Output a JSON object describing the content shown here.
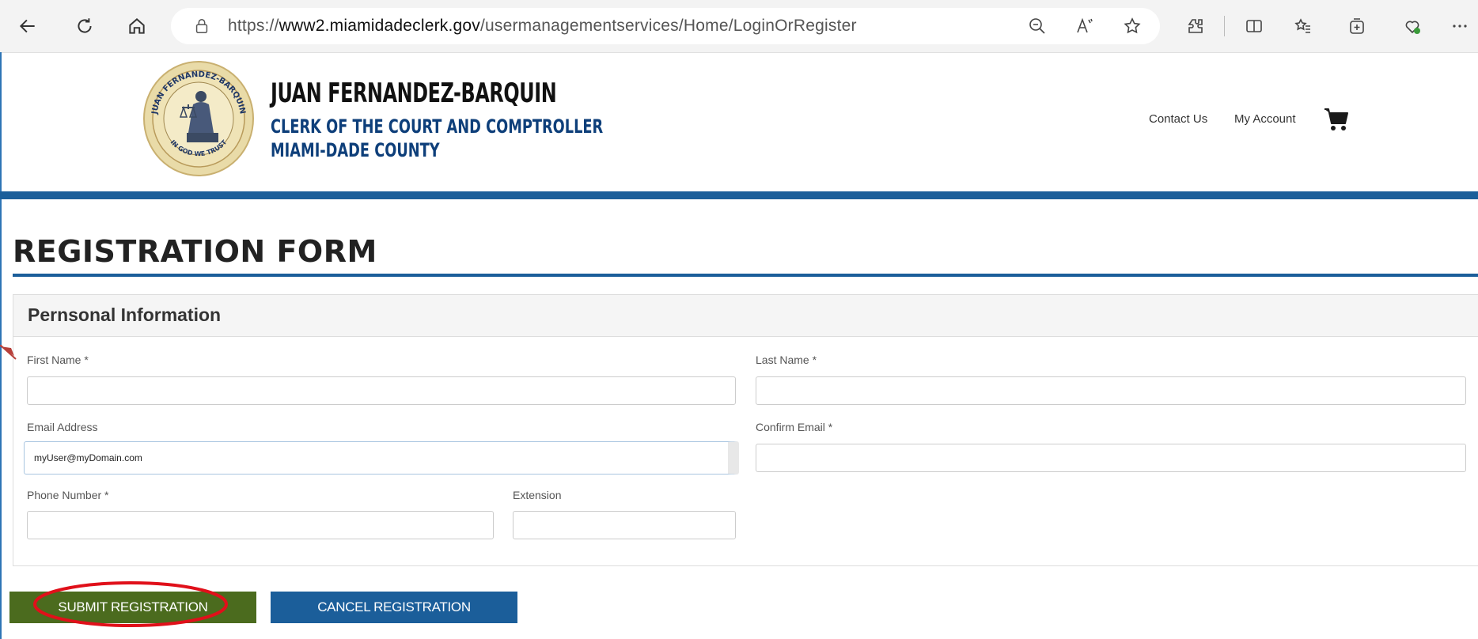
{
  "browser": {
    "url_prefix": "https://",
    "url_domain": "www2.miamidadeclerk.gov",
    "url_path": "/usermanagementservices/Home/LoginOrRegister",
    "icons": [
      "back-icon",
      "refresh-icon",
      "home-icon",
      "lock-icon",
      "zoom-out-icon",
      "read-aloud-icon",
      "favorite-star-icon",
      "extensions-icon",
      "split-screen-icon",
      "favorites-list-icon",
      "collections-icon",
      "browser-essentials-icon",
      "more-icon"
    ]
  },
  "header": {
    "org_name": "JUAN FERNANDEZ-BARQUIN",
    "org_line2": "CLERK OF THE COURT AND COMPTROLLER",
    "org_line3": "MIAMI-DADE COUNTY",
    "seal_top_text": "JUAN FERNANDEZ-BARQUIN",
    "seal_bottom_text": "IN GOD WE TRUST",
    "contact_label": "Contact Us",
    "account_label": "My Account",
    "cart_icon": "cart-icon"
  },
  "form": {
    "title": "REGISTRATION FORM",
    "section_title": "Pernsonal Information",
    "first_name_label": "First Name *",
    "last_name_label": "Last Name *",
    "email_label": "Email Address",
    "email_value": "myUser@myDomain.com",
    "confirm_email_label": "Confirm Email *",
    "phone_label": "Phone Number *",
    "extension_label": "Extension"
  },
  "buttons": {
    "submit_label": "SUBMIT REGISTRATION",
    "cancel_label": "CANCEL REGISTRATION"
  },
  "colors": {
    "brand_blue": "#1b5e9a",
    "submit_green": "#4b6b1e",
    "annotation_red": "#e0101a"
  }
}
